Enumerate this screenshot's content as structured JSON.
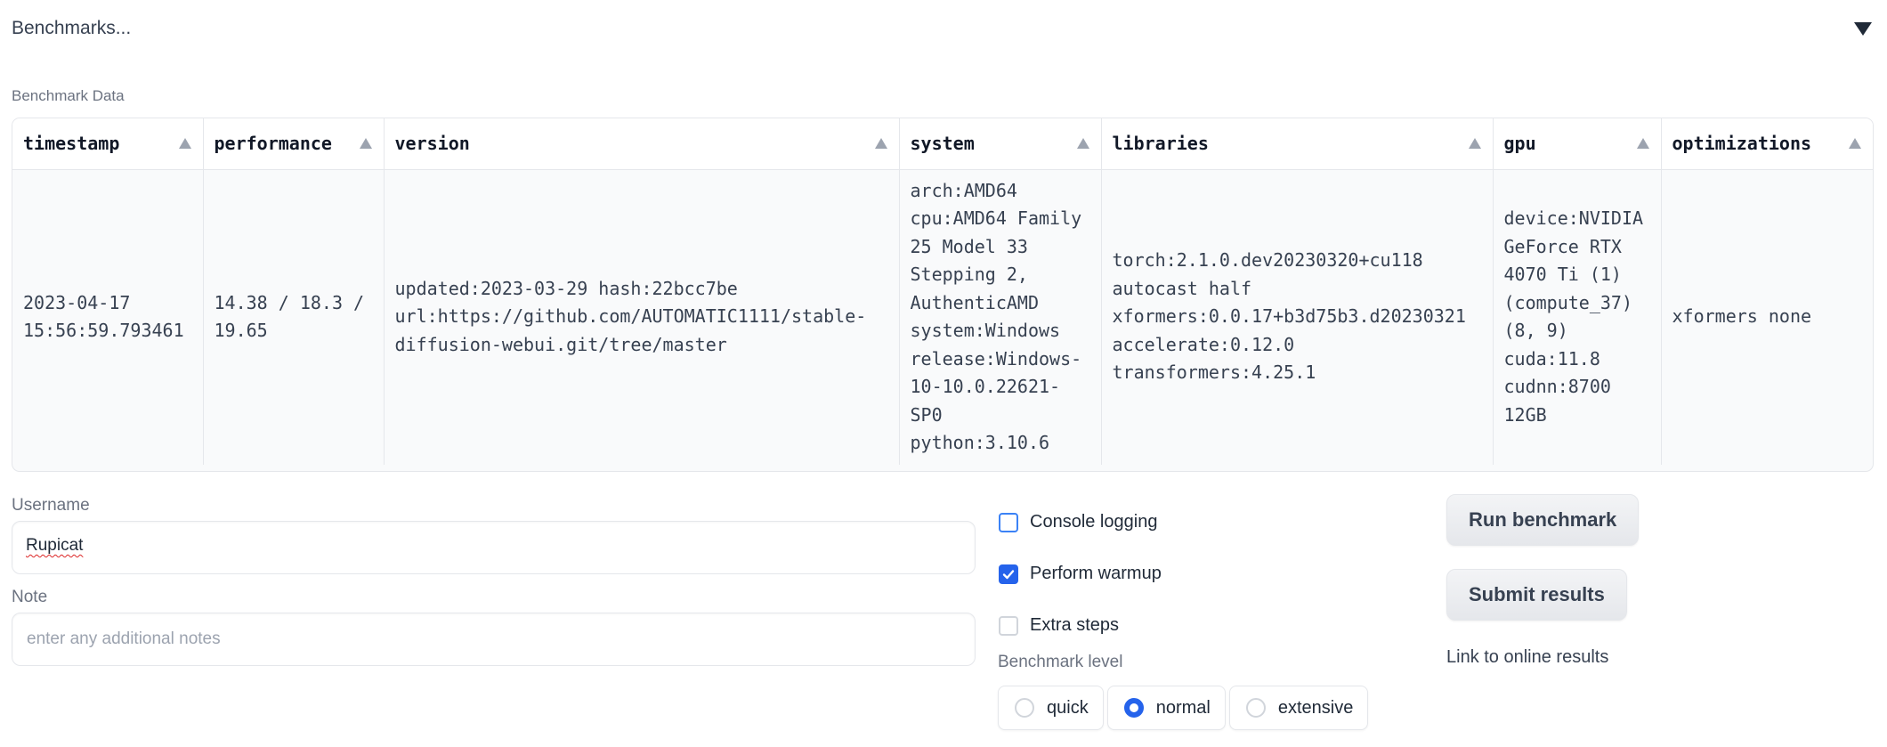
{
  "accordion": {
    "title": "Benchmarks..."
  },
  "table": {
    "label": "Benchmark Data",
    "columns": [
      "timestamp",
      "performance",
      "version",
      "system",
      "libraries",
      "gpu",
      "optimizations"
    ],
    "rows": [
      {
        "timestamp": "2023-04-17\n15:56:59.793461",
        "performance": "14.38 / 18.3 /\n19.65",
        "version": "updated:2023-03-29 hash:22bcc7be\nurl:https://github.com/AUTOMATIC1111/stable-\ndiffusion-webui.git/tree/master",
        "system": "arch:AMD64\ncpu:AMD64 Family\n25 Model 33\nStepping 2,\nAuthenticAMD\nsystem:Windows\nrelease:Windows-\n10-10.0.22621-\nSP0\npython:3.10.6",
        "libraries": "torch:2.1.0.dev20230320+cu118\nautocast half\nxformers:0.0.17+b3d75b3.d20230321\naccelerate:0.12.0\ntransformers:4.25.1",
        "gpu": "device:NVIDIA\nGeForce RTX\n4070 Ti (1)\n(compute_37)\n(8, 9)\ncuda:11.8\ncudnn:8700\n12GB",
        "optimizations": "xformers none"
      }
    ]
  },
  "form": {
    "username_label": "Username",
    "username_value": "Rupicat",
    "note_label": "Note",
    "note_placeholder": "enter any additional notes",
    "console_logging_label": "Console logging",
    "console_logging_checked": false,
    "perform_warmup_label": "Perform warmup",
    "perform_warmup_checked": true,
    "extra_steps_label": "Extra steps",
    "extra_steps_checked": false,
    "benchmark_level_label": "Benchmark level",
    "benchmark_level_options": [
      "quick",
      "normal",
      "extensive"
    ],
    "benchmark_level_selected": "normal"
  },
  "actions": {
    "run_label": "Run benchmark",
    "submit_label": "Submit results",
    "link_label": "Link to online results"
  },
  "colors": {
    "accent": "#2563eb",
    "focus_border": "#3b82f6"
  }
}
